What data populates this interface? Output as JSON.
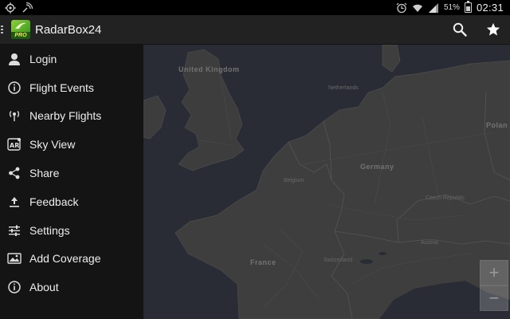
{
  "status": {
    "battery_percent": "51%",
    "time": "02:31",
    "icons": [
      "gps-icon",
      "signal-radiate-icon",
      "alarm-icon",
      "wifi-icon",
      "cell-signal-icon",
      "battery-icon"
    ]
  },
  "app": {
    "title": "RadarBox24",
    "logo_badge": "PRO",
    "accent": "#7cc536"
  },
  "menu": {
    "items": [
      {
        "label": "Login",
        "icon": "user-icon"
      },
      {
        "label": "Flight Events",
        "icon": "info-icon"
      },
      {
        "label": "Nearby Flights",
        "icon": "location-radiate-icon"
      },
      {
        "label": "Sky View",
        "icon": "ar-icon"
      },
      {
        "label": "Share",
        "icon": "share-icon"
      },
      {
        "label": "Feedback",
        "icon": "upload-icon"
      },
      {
        "label": "Settings",
        "icon": "sliders-icon"
      },
      {
        "label": "Add Coverage",
        "icon": "map-image-icon"
      },
      {
        "label": "About",
        "icon": "info-icon"
      }
    ]
  },
  "map": {
    "labels": {
      "united_kingdom": "United Kingdom",
      "netherlands": "Netherlands",
      "germany": "Germany",
      "belgium": "Belgium",
      "czech_republic": "Czech Republic",
      "france": "France",
      "switzerland": "Switzerland",
      "austria": "Austria",
      "poland": "Polan"
    },
    "zoom_in": "+",
    "zoom_out": "−"
  }
}
